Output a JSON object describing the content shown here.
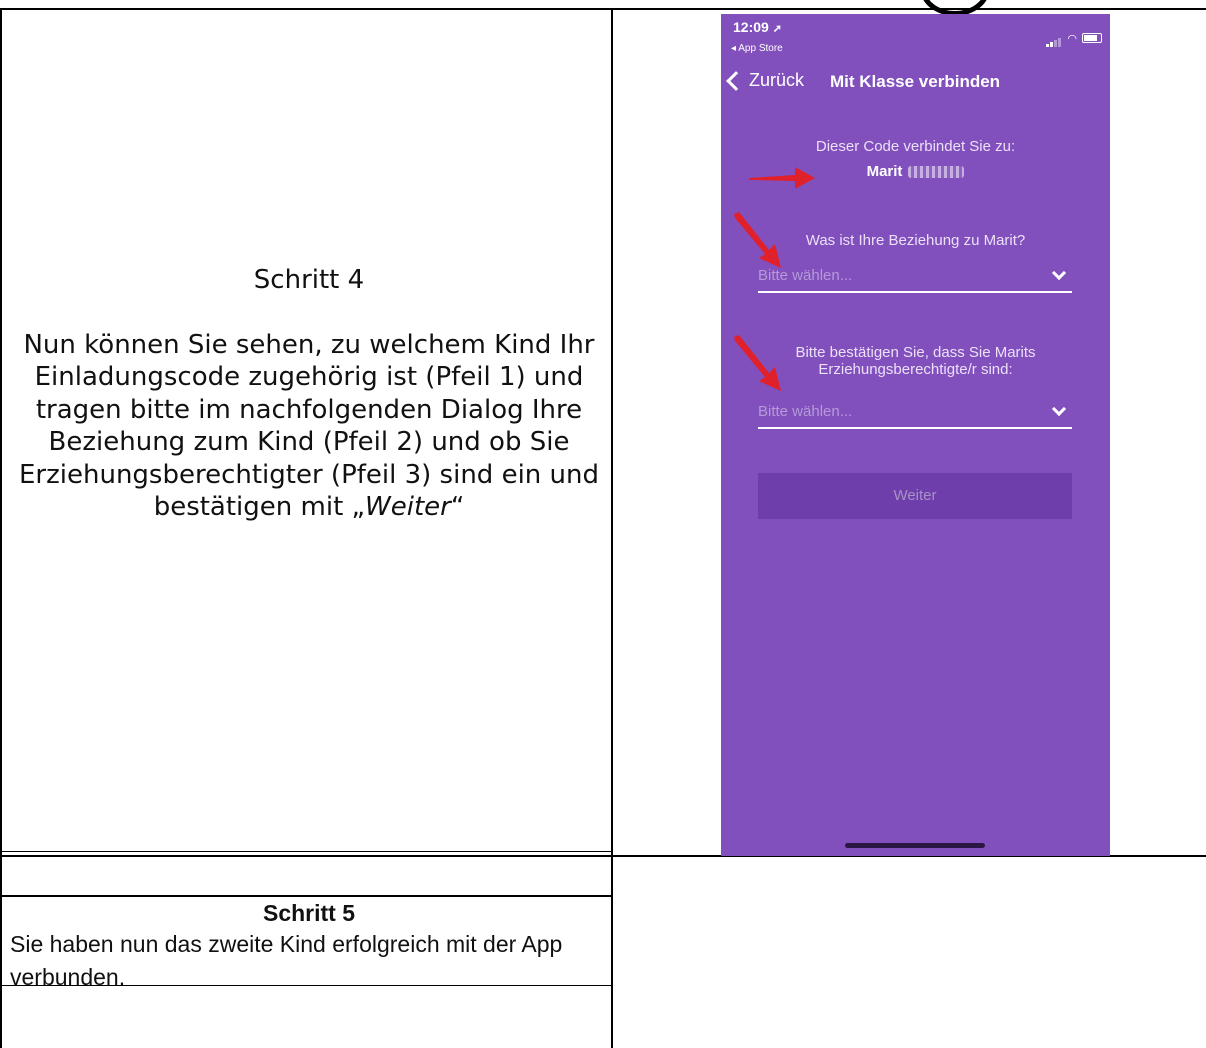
{
  "step4": {
    "title": "Schritt 4",
    "body_part1": "Nun können Sie sehen, zu welchem Kind Ihr Einladungscode zugehörig ist (Pfeil 1) und tragen bitte im nachfolgenden Dialog Ihre Beziehung zum Kind (Pfeil 2) und ob Sie Erziehungsberechtigter (Pfeil 3) sind ein und bestätigen mit „",
    "body_emphasis": "Weiter",
    "body_part2": "“"
  },
  "step5": {
    "title": "Schritt 5",
    "body": "Sie haben nun das zweite Kind erfolgreich mit der App verbunden."
  },
  "phone": {
    "status_time": "12:09",
    "status_back": "◂ App Store",
    "nav_back": "Zurück",
    "nav_title": "Mit Klasse verbinden",
    "code_label": "Dieser Code verbindet Sie zu:",
    "code_name": "Marit",
    "question_relationship": "Was ist Ihre Beziehung zu Marit?",
    "select_placeholder_1": "Bitte wählen...",
    "question_guardian": "Bitte bestätigen Sie, dass Sie Marits Erziehungsberechtigte/r sind:",
    "select_placeholder_2": "Bitte wählen...",
    "continue_button": "Weiter",
    "colors": {
      "background": "#8150bd",
      "button": "#6e3faa",
      "arrow": "#e0212b"
    }
  }
}
